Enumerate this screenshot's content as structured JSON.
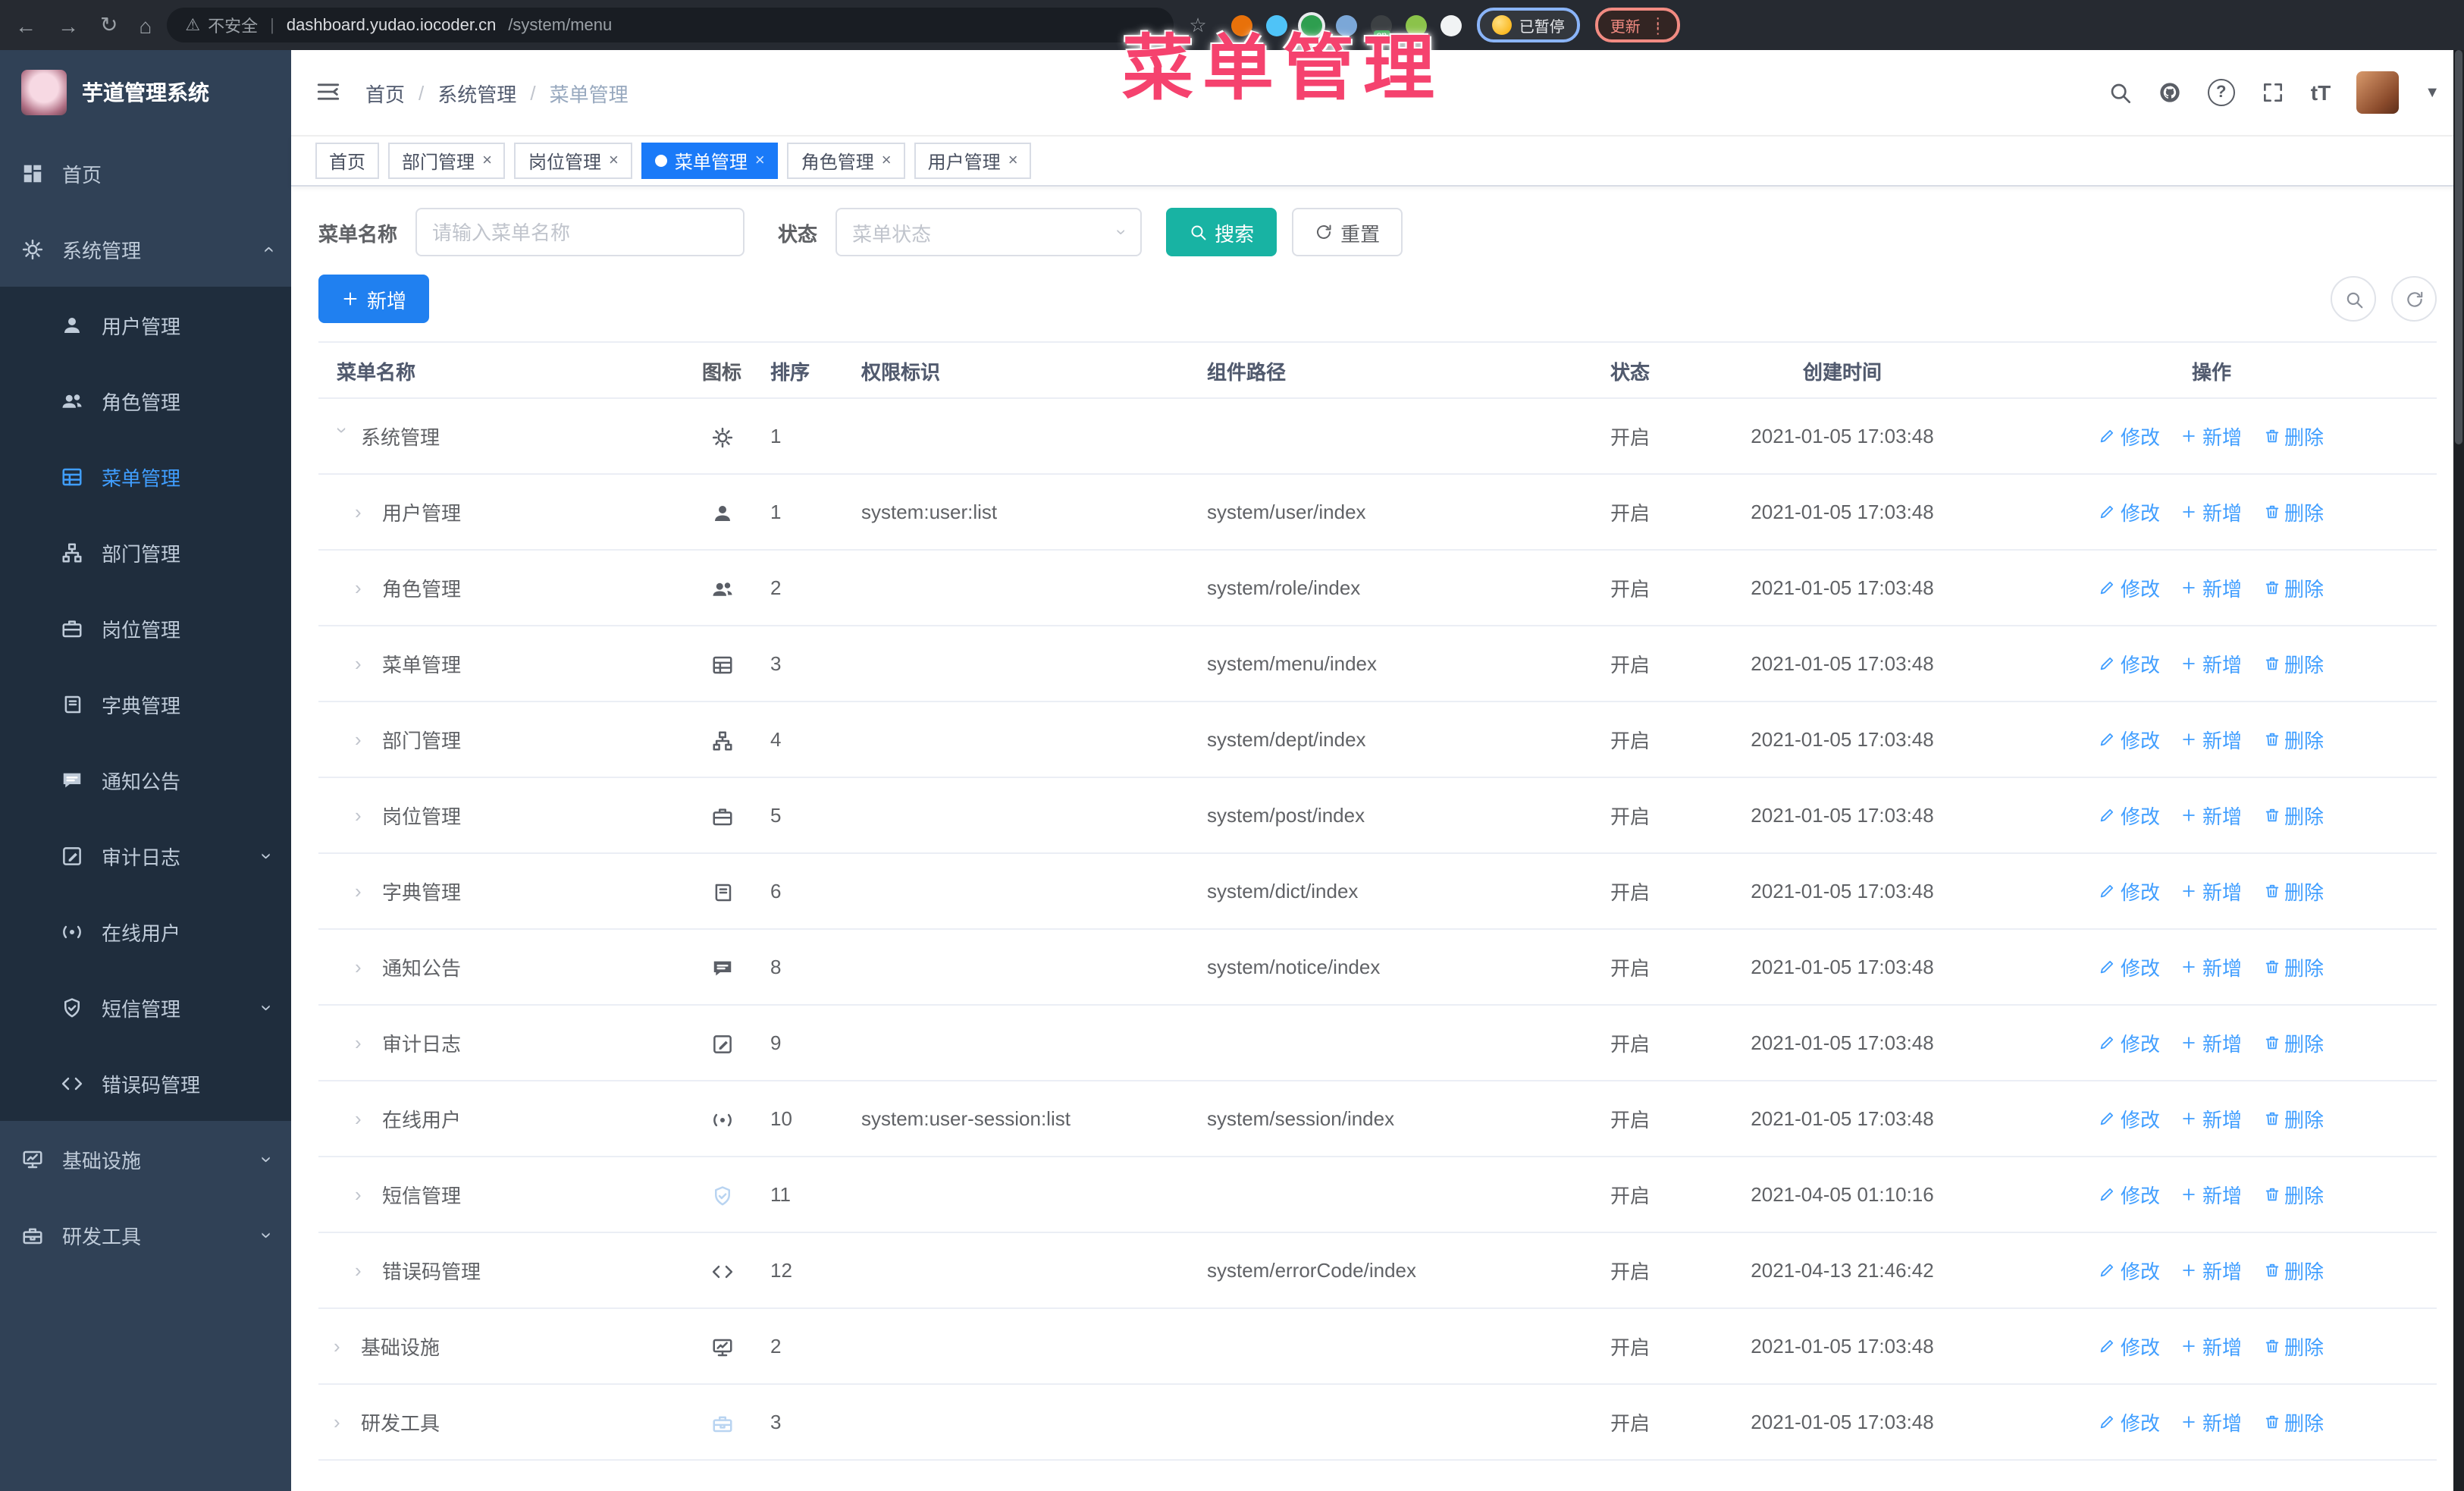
{
  "colors": {
    "primary": "#2080f0",
    "link": "#409eff",
    "teal": "#18b3a3",
    "tab_active": "#1a7af8",
    "sidebar_bg": "#304156",
    "sidebar_sub_bg": "#1f2d3d",
    "overlay_pink": "#f5426e"
  },
  "browser": {
    "security_warning": "不安全",
    "url_host": "dashboard.yudao.iocoder.cn",
    "url_path": "/system/menu",
    "paused_badge": "已暂停",
    "update_button": "更新",
    "extensions": [
      {
        "name": "ext-orange-circle",
        "style": "background:#e8710a"
      },
      {
        "name": "ext-blue-gem",
        "style": "background:#4fc3f7"
      },
      {
        "name": "ext-green-check",
        "style": "background:#2e9e4f;box-shadow:0 0 0 2px #e8eaed"
      },
      {
        "name": "ext-blue-gray",
        "style": "background:#7ba7d7"
      },
      {
        "name": "ext-dark-on",
        "style": "background:#3c4043",
        "badge": "on"
      },
      {
        "name": "ext-green-animal",
        "style": "background:#8bc34a"
      },
      {
        "name": "ext-puzzle",
        "style": "background:#f1f3f4"
      }
    ]
  },
  "overlay": {
    "title": "菜单管理",
    "css": "color:#f5426e"
  },
  "sidebar": {
    "app_title": "芋道管理系统",
    "items": [
      {
        "label": "首页",
        "icon": "#i-home",
        "cls": "top"
      },
      {
        "label": "系统管理",
        "icon": "#i-gear",
        "cls": "top has-arrow arr-up"
      },
      {
        "label": "用户管理",
        "icon": "#i-user",
        "cls": "sub"
      },
      {
        "label": "角色管理",
        "icon": "#i-users",
        "cls": "sub"
      },
      {
        "label": "菜单管理",
        "icon": "#i-list",
        "cls": "sub active"
      },
      {
        "label": "部门管理",
        "icon": "#i-tree",
        "cls": "sub"
      },
      {
        "label": "岗位管理",
        "icon": "#i-briefcase",
        "cls": "sub"
      },
      {
        "label": "字典管理",
        "icon": "#i-dict",
        "cls": "sub"
      },
      {
        "label": "通知公告",
        "icon": "#i-notice",
        "cls": "sub"
      },
      {
        "label": "审计日志",
        "icon": "#i-audit",
        "cls": "sub has-arrow arr-down"
      },
      {
        "label": "在线用户",
        "icon": "#i-online",
        "cls": "sub"
      },
      {
        "label": "短信管理",
        "icon": "#i-sms",
        "cls": "sub has-arrow arr-down"
      },
      {
        "label": "错误码管理",
        "icon": "#i-code",
        "cls": "sub"
      },
      {
        "label": "基础设施",
        "icon": "#i-monitor",
        "cls": "top has-arrow arr-down"
      },
      {
        "label": "研发工具",
        "icon": "#i-tool",
        "cls": "top has-arrow arr-down"
      }
    ]
  },
  "header": {
    "breadcrumb": [
      "首页",
      "系统管理",
      "菜单管理"
    ],
    "sep": "/"
  },
  "tabs": [
    {
      "label": "首页",
      "cls": "no-close",
      "close": "×"
    },
    {
      "label": "部门管理",
      "cls": "",
      "close": "×"
    },
    {
      "label": "岗位管理",
      "cls": "",
      "close": "×"
    },
    {
      "label": "菜单管理",
      "cls": "active",
      "close": "×"
    },
    {
      "label": "角色管理",
      "cls": "",
      "close": "×"
    },
    {
      "label": "用户管理",
      "cls": "",
      "close": "×"
    }
  ],
  "filters": {
    "name_label": "菜单名称",
    "name_placeholder": "请输入菜单名称",
    "status_label": "状态",
    "status_placeholder": "菜单状态",
    "search_label": "搜索",
    "reset_label": "重置"
  },
  "toolbar": {
    "add_label": "新增"
  },
  "actions": {
    "edit": "修改",
    "add": "新增",
    "delete": "删除"
  },
  "table": {
    "columns": {
      "name": "菜单名称",
      "icon": "图标",
      "sort": "排序",
      "perms": "权限标识",
      "component": "组件路径",
      "status": "状态",
      "created": "创建时间",
      "ops": "操作"
    },
    "rows": [
      {
        "name": "系统管理",
        "icon": "#i-gear",
        "icls": "",
        "cls": "lv0 expanded",
        "sort": "1",
        "perms": "",
        "component": "",
        "status": "开启",
        "time": "2021-01-05 17:03:48"
      },
      {
        "name": "用户管理",
        "icon": "#i-user",
        "icls": "",
        "cls": "lv1",
        "sort": "1",
        "perms": "system:user:list",
        "component": "system/user/index",
        "status": "开启",
        "time": "2021-01-05 17:03:48"
      },
      {
        "name": "角色管理",
        "icon": "#i-users",
        "icls": "",
        "cls": "lv1",
        "sort": "2",
        "perms": "",
        "component": "system/role/index",
        "status": "开启",
        "time": "2021-01-05 17:03:48"
      },
      {
        "name": "菜单管理",
        "icon": "#i-list",
        "icls": "",
        "cls": "lv1",
        "sort": "3",
        "perms": "",
        "component": "system/menu/index",
        "status": "开启",
        "time": "2021-01-05 17:03:48"
      },
      {
        "name": "部门管理",
        "icon": "#i-tree",
        "icls": "",
        "cls": "lv1",
        "sort": "4",
        "perms": "",
        "component": "system/dept/index",
        "status": "开启",
        "time": "2021-01-05 17:03:48"
      },
      {
        "name": "岗位管理",
        "icon": "#i-briefcase",
        "icls": "",
        "cls": "lv1",
        "sort": "5",
        "perms": "",
        "component": "system/post/index",
        "status": "开启",
        "time": "2021-01-05 17:03:48"
      },
      {
        "name": "字典管理",
        "icon": "#i-dict",
        "icls": "",
        "cls": "lv1",
        "sort": "6",
        "perms": "",
        "component": "system/dict/index",
        "status": "开启",
        "time": "2021-01-05 17:03:48"
      },
      {
        "name": "通知公告",
        "icon": "#i-notice",
        "icls": "",
        "cls": "lv1",
        "sort": "8",
        "perms": "",
        "component": "system/notice/index",
        "status": "开启",
        "time": "2021-01-05 17:03:48"
      },
      {
        "name": "审计日志",
        "icon": "#i-audit",
        "icls": "",
        "cls": "lv1",
        "sort": "9",
        "perms": "",
        "component": "",
        "status": "开启",
        "time": "2021-01-05 17:03:48"
      },
      {
        "name": "在线用户",
        "icon": "#i-online",
        "icls": "",
        "cls": "lv1",
        "sort": "10",
        "perms": "system:user-session:list",
        "component": "system/session/index",
        "status": "开启",
        "time": "2021-01-05 17:03:48"
      },
      {
        "name": "短信管理",
        "icon": "#i-sms",
        "icls": "muted",
        "cls": "lv1",
        "sort": "11",
        "perms": "",
        "component": "",
        "status": "开启",
        "time": "2021-04-05 01:10:16"
      },
      {
        "name": "错误码管理",
        "icon": "#i-code",
        "icls": "",
        "cls": "lv1",
        "sort": "12",
        "perms": "",
        "component": "system/errorCode/index",
        "status": "开启",
        "time": "2021-04-13 21:46:42"
      },
      {
        "name": "基础设施",
        "icon": "#i-monitor",
        "icls": "",
        "cls": "lv0",
        "sort": "2",
        "perms": "",
        "component": "",
        "status": "开启",
        "time": "2021-01-05 17:03:48"
      },
      {
        "name": "研发工具",
        "icon": "#i-tool",
        "icls": "muted",
        "cls": "lv0",
        "sort": "3",
        "perms": "",
        "component": "",
        "status": "开启",
        "time": "2021-01-05 17:03:48"
      }
    ]
  }
}
